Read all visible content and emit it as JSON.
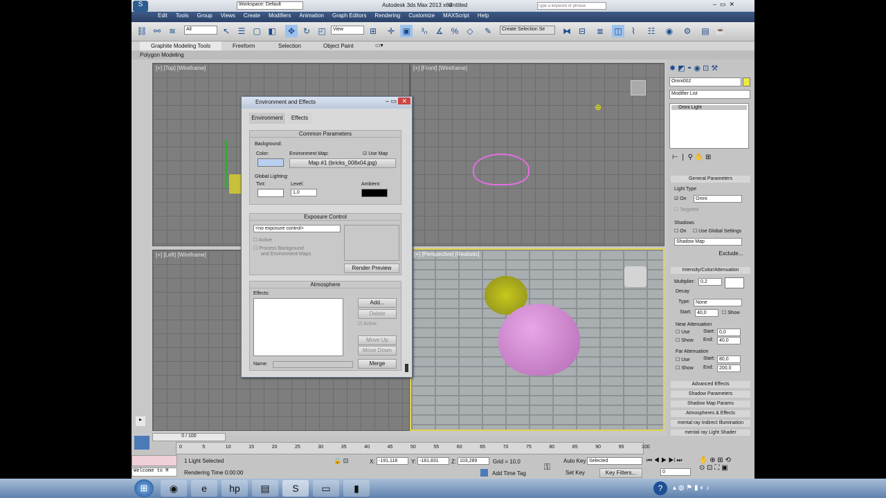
{
  "title": {
    "workspace": "Workspace: Default",
    "app": "Autodesk 3ds Max  2013 x64",
    "file": "Untitled",
    "search_placeholder": "Type a keyword or phrase"
  },
  "menu": [
    "Edit",
    "Tools",
    "Group",
    "Views",
    "Create",
    "Modifiers",
    "Animation",
    "Graph Editors",
    "Rendering",
    "Customize",
    "MAXScript",
    "Help"
  ],
  "toolbar": {
    "filter": "All",
    "view": "View",
    "selection_set": "Create Selection Se"
  },
  "ribbon": {
    "tabs": [
      "Graphite Modeling Tools",
      "Freeform",
      "Selection",
      "Object Paint"
    ],
    "sub": "Polygon Modeling"
  },
  "viewports": {
    "top": "[+] [Top] [Wireframe]",
    "front": "[+] [Front] [Wireframe]",
    "left": "[+] [Left] [Wireframe]",
    "persp": "[+] [Perspective] [Realistic]"
  },
  "dialog": {
    "title": "Environment and Effects",
    "tabs": [
      "Environment",
      "Effects"
    ],
    "common": {
      "head": "Common Parameters",
      "background": "Background:",
      "color": "Color:",
      "env_map": "Environment Map:",
      "use_map": "Use Map",
      "map_name": "Map #1 (bricks_008x04.jpg)",
      "global_lighting": "Global Lighting:",
      "tint": "Tint:",
      "level": "Level:",
      "level_value": "1,0",
      "ambient": "Ambient:"
    },
    "exposure": {
      "head": "Exposure Control",
      "select": "<no exposure control>",
      "active": "Active",
      "process": "Process Background",
      "process2": "and Environment Maps",
      "render_preview": "Render Preview"
    },
    "atmosphere": {
      "head": "Atmosphere",
      "effects": "Effects:",
      "add": "Add...",
      "delete": "Delete",
      "active": "Active",
      "move_up": "Move Up",
      "move_down": "Move Down",
      "name": "Name:",
      "merge": "Merge"
    }
  },
  "cmd": {
    "object_name": "Omni002",
    "modifier_list": "Modifier List",
    "stack_item": "Omni Light",
    "general": {
      "head": "General Parameters",
      "light_type": "Light Type",
      "on": "On",
      "type": "Omni",
      "targeted": "Targeted",
      "shadows": "Shadows",
      "use_global": "Use Global Settings",
      "shadow_map": "Shadow Map",
      "exclude": "Exclude..."
    },
    "intensity": {
      "head": "Intensity/Color/Attenuation",
      "multiplier": "Multiplier:",
      "mult_value": "0,2",
      "decay": "Decay",
      "type": "Type:",
      "type_value": "None",
      "start": "Start:",
      "start_value": "40,0",
      "show": "Show",
      "near": "Near Attenuation",
      "use": "Use",
      "end": "End:",
      "near_start": "0,0",
      "near_end": "40,0",
      "far": "Far Attenuation",
      "far_start": "80,0",
      "far_end": "200,0"
    },
    "rollouts": [
      "Advanced Effects",
      "Shadow Parameters",
      "Shadow Map Params",
      "Atmospheres & Effects",
      "mental ray Indirect Illumination",
      "mental ray Light Shader"
    ]
  },
  "timeline": {
    "frame": "0 / 100",
    "ticks": [
      "0",
      "5",
      "10",
      "15",
      "20",
      "25",
      "30",
      "35",
      "40",
      "45",
      "50",
      "55",
      "60",
      "65",
      "70",
      "75",
      "80",
      "85",
      "90",
      "95",
      "100"
    ]
  },
  "status": {
    "welcome": "Welcome to M",
    "selected": "1 Light Selected",
    "render_time": "Rendering Time  0:00:00",
    "x": "-191,118",
    "y": "-181,831",
    "z": "103,289",
    "grid": "Grid = 10,0",
    "add_time_tag": "Add Time Tag",
    "auto_key": "Auto Key",
    "selected_dd": "Selected",
    "set_key": "Set Key",
    "key_filters": "Key Filters...",
    "frame_field": "0"
  }
}
